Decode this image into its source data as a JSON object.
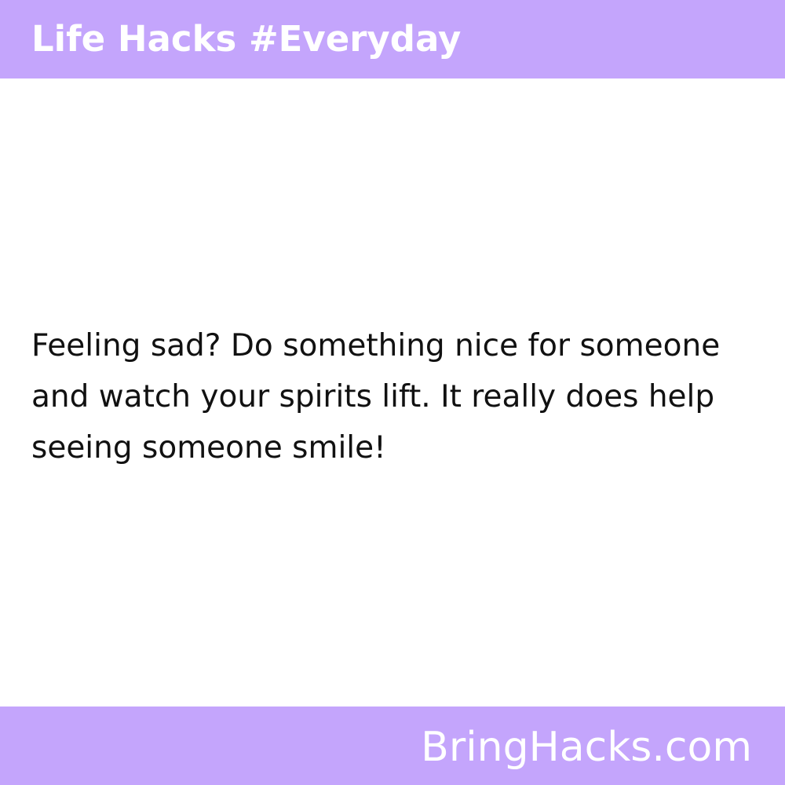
{
  "header": {
    "title": "Life Hacks #Everyday"
  },
  "main": {
    "text": "Feeling sad? Do something nice for someone and watch your spirits lift. It really does help seeing someone smile!"
  },
  "footer": {
    "site": "BringHacks.com"
  },
  "colors": {
    "bar": "#c4a5fc",
    "background": "#ffffff",
    "text": "#111111",
    "bar_text": "#ffffff"
  }
}
